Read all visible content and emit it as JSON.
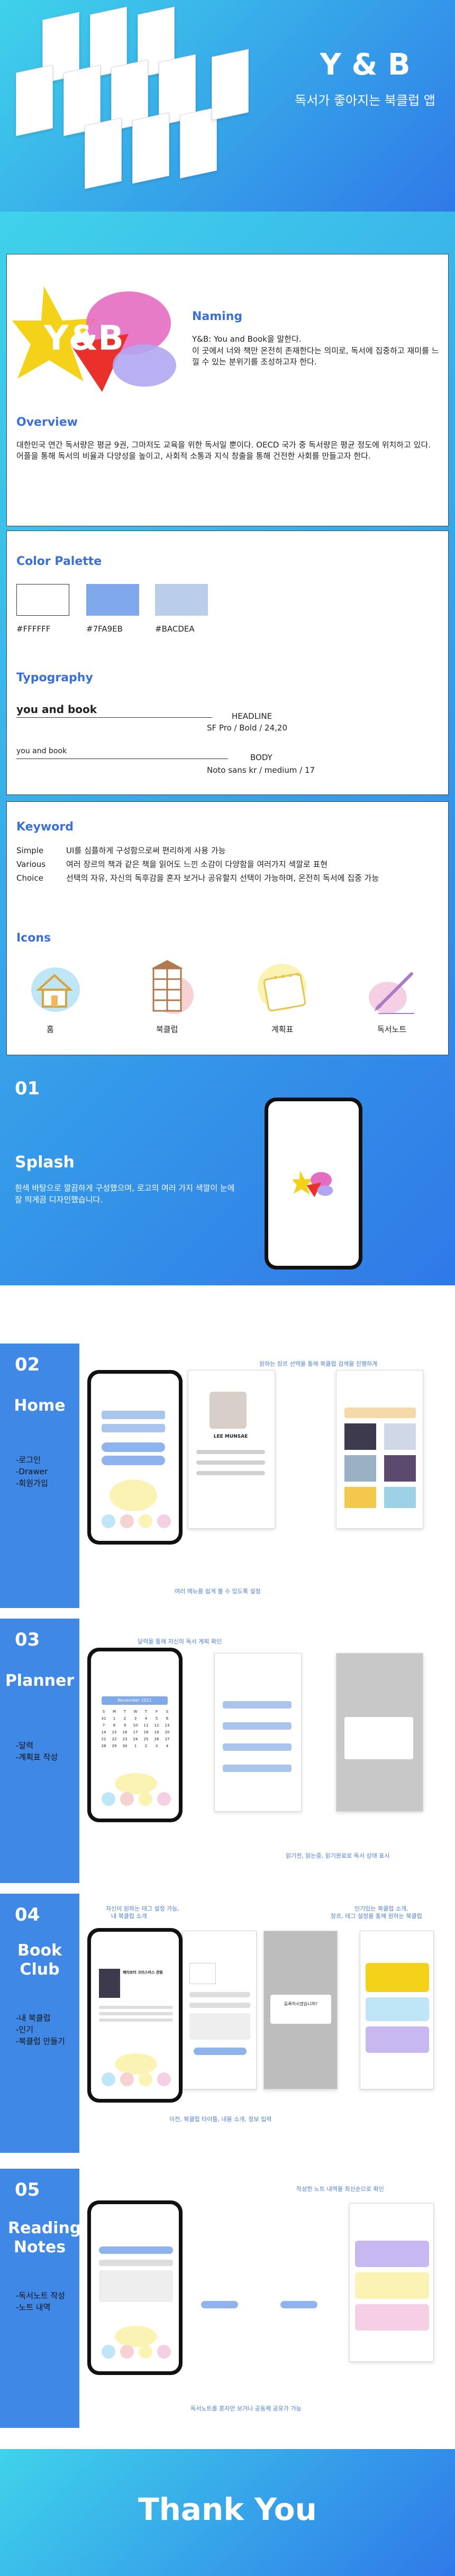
{
  "hero": {
    "title": "Y & B",
    "subtitle": "독서가 좋아지는 북클럽 앱"
  },
  "naming": {
    "heading": "Naming",
    "line1": "Y&B: You and Book을 말한다.",
    "line2": "이 곳에서 너와 책만 온전히 존재한다는 의미로, 독서에 집중하고 재미를 느낄 수 있는 분위기를 조성하고자 한다."
  },
  "overview": {
    "heading": "Overview",
    "text": "대한민국 연간 독서량은 평균 9권, 그마저도 교육을 위한 독서일 뿐이다. OECD 국가 중 독서량은 평균 정도에 위치하고 있다. 어플을 통해 독서의 비율과 다양성을 높이고, 사회적 소통과 지식 창출을 통해 건전한 사회를 만들고자 한다."
  },
  "palette": {
    "heading": "Color Palette",
    "colors": [
      {
        "hex": "#FFFFFF",
        "label": "#FFFFFF"
      },
      {
        "hex": "#7FA9EB",
        "label": "#7FA9EB"
      },
      {
        "hex": "#BACDEA",
        "label": "#BACDEA"
      }
    ]
  },
  "typography": {
    "heading": "Typography",
    "headline_sample": "you and book",
    "headline_label": "HEADLINE",
    "headline_spec": "SF Pro / Bold / 24,20",
    "body_sample": "you and book",
    "body_label": "BODY",
    "body_spec": "Noto sans kr / medium / 17"
  },
  "keyword": {
    "heading": "Keyword",
    "items": [
      {
        "term": "Simple",
        "desc": "UI를 심플하게 구성함으로써 편리하게 사용 가능"
      },
      {
        "term": "Various",
        "desc": "여러 장르의 책과 같은 책을 읽어도 느낀 소감이 다양함을 여러가지 색깔로 표현"
      },
      {
        "term": "Choice",
        "desc": "선택의 자유, 자신의 독후감을 혼자 보거나 공유할지 선택이 가능하며, 온전히 독서에 집중 가능"
      }
    ]
  },
  "icons": {
    "heading": "Icons",
    "items": [
      {
        "name": "home-icon",
        "label": "홈"
      },
      {
        "name": "bookclub-icon",
        "label": "북클럽"
      },
      {
        "name": "planner-icon",
        "label": "계획표"
      },
      {
        "name": "note-icon",
        "label": "독서노트"
      }
    ]
  },
  "splash": {
    "num": "01",
    "title": "Splash",
    "desc": "흰색 바탕으로 깔끔하게 구성했으며, 로고의 여러 가지 색깔이 눈에 잘 띄게끔 디자인했습니다."
  },
  "home": {
    "num": "02",
    "title": "Home",
    "features": [
      "-로그인",
      "-Drawer",
      "-회원가입"
    ],
    "note_top": "원하는 장르 선택을 통해 북클럽 검색을 진행하게",
    "note_bottom": "여러 메뉴를 쉽게 볼 수 있도록 설정",
    "profile_name": "LEE MUNSAE"
  },
  "planner": {
    "num": "03",
    "title": "Planner",
    "features": [
      "-달력",
      "-계획표 작성"
    ],
    "note_top": "달력을 통해 자신의 독서 계획 확인",
    "note_bottom": "읽기전, 읽는중, 읽기완료로 독서 상태 표시",
    "month": "November 2021",
    "days": [
      "S",
      "M",
      "T",
      "W",
      "T",
      "F",
      "S"
    ],
    "dates": [
      "31",
      "1",
      "2",
      "3",
      "4",
      "5",
      "6",
      "7",
      "8",
      "9",
      "10",
      "11",
      "12",
      "13",
      "14",
      "15",
      "16",
      "17",
      "18",
      "19",
      "20",
      "21",
      "22",
      "23",
      "24",
      "25",
      "26",
      "27",
      "28",
      "29",
      "30",
      "1",
      "2",
      "3",
      "4"
    ]
  },
  "bookclub": {
    "num": "04",
    "title": "Book Club",
    "features": [
      "-내 북클럽",
      "-인기",
      "-북클럽 만들기"
    ],
    "note_top_left": "자신이 원하는 테그 설정 가능,",
    "note_top_left2": "내 북클럽 소개",
    "note_top_right": "인기있는 북클럽 소개,",
    "note_top_right2": "장르, 테그 설정을 통해 원하는 북클럽",
    "note_bottom": "이전, 북클럽 타이틀, 내용 소개, 정보 입력",
    "dialog": "등록하시겠습니까?",
    "book_title": "해리포터 크리스마스 관람"
  },
  "notes": {
    "num": "05",
    "title": "Reading Notes",
    "features": [
      "-독서노트 작성",
      "-노트 내역"
    ],
    "note_top": "작성한 노트 내역을 최신순으로 확인",
    "note_bottom": "독서노트를 혼자만 보거나 공동체 공유가 가능"
  },
  "footer": {
    "text": "Thank You"
  }
}
